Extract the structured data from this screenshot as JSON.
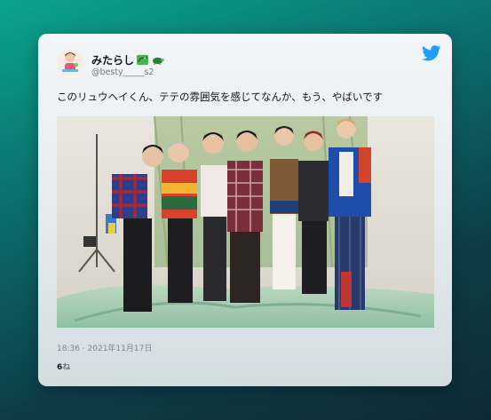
{
  "tweet": {
    "display_name": "みたらし",
    "name_emojis": [
      "dragon-icon",
      "turtle-icon"
    ],
    "handle": "@besty_____s2",
    "text": "このリュウヘイくん、テテの雰囲気を感じてなんか、もう、やばいです",
    "timestamp": "18:36 · 2021年11月17日",
    "like_count": "6",
    "like_suffix": "ね",
    "photo_icon": "group-photo",
    "brand_icon": "twitter-bird-icon",
    "colors": {
      "brand": "#1da1f2",
      "text": "#14171a",
      "secondary": "#7b8892"
    }
  }
}
